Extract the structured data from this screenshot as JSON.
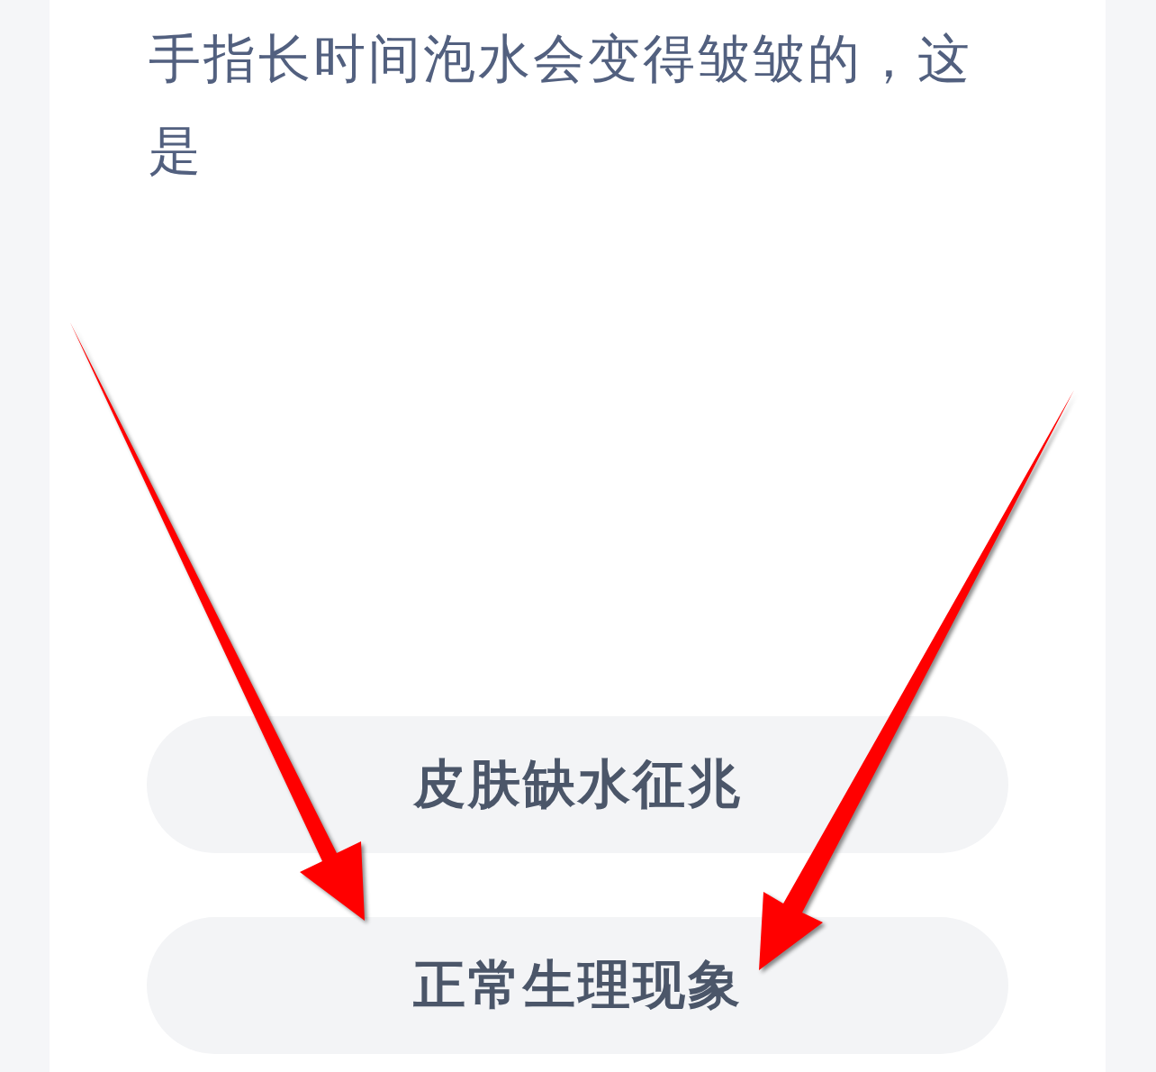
{
  "question": {
    "text": "手指长时间泡水会变得皱皱的，这是"
  },
  "options": [
    {
      "label": "皮肤缺水征兆"
    },
    {
      "label": "正常生理现象"
    }
  ],
  "annotations": [
    {
      "kind": "arrow"
    },
    {
      "kind": "arrow"
    }
  ]
}
